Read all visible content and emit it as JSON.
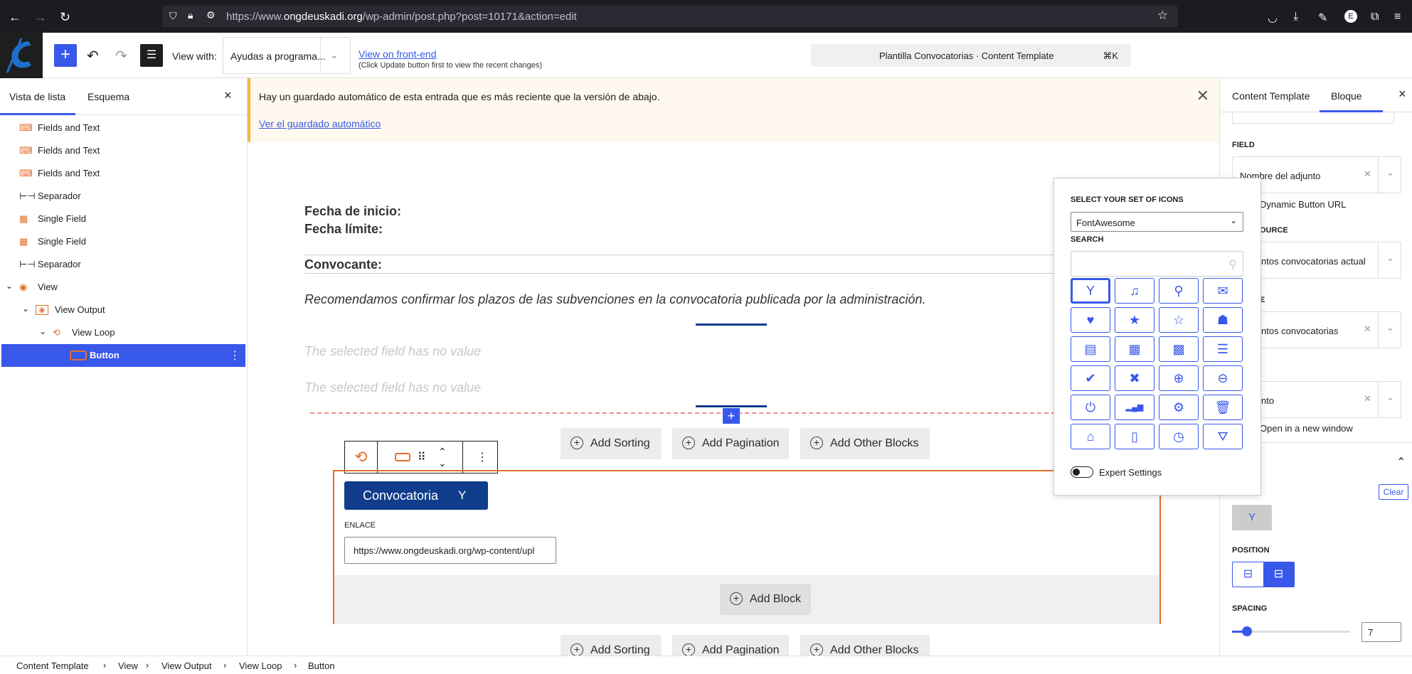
{
  "browser": {
    "url_prefix": "https://www.",
    "url_domain": "ongdeuskadi.org",
    "url_suffix": "/wp-admin/post.php?post=10171&action=edit"
  },
  "header": {
    "view_with_label": "View with:",
    "view_with_value": "Ayudas a programa...",
    "view_front_link": "View on front-end",
    "view_front_note": "(Click Update button first to view the recent changes)",
    "command_title": "Plantilla Convocatorias · Content Template",
    "command_shortcut": "⌘K"
  },
  "left_panel": {
    "tabs": [
      "Vista de lista",
      "Esquema"
    ],
    "items": [
      {
        "label": "Fields and Text"
      },
      {
        "label": "Fields and Text"
      },
      {
        "label": "Fields and Text"
      },
      {
        "label": "Separador"
      },
      {
        "label": "Single Field"
      },
      {
        "label": "Single Field"
      },
      {
        "label": "Separador"
      },
      {
        "label": "View"
      },
      {
        "label": "View Output"
      },
      {
        "label": "View Loop"
      },
      {
        "label": "Button"
      }
    ]
  },
  "notice": {
    "text": "Hay un guardado automático de esta entrada que es más reciente que la versión de abajo.",
    "link": "Ver el guardado automático"
  },
  "canvas": {
    "fecha_inicio": "Fecha de inicio:",
    "fecha_limite": "Fecha límite:",
    "convocante": "Convocante:",
    "recommendation": "Recomendamos confirmar los plazos de las subvenciones en la convocatoria publicada por la administración.",
    "no_value_1": "The selected field has no value",
    "no_value_2": "The selected field has no value",
    "add_sorting": "Add Sorting",
    "add_pagination": "Add Pagination",
    "add_other_blocks": "Add Other Blocks",
    "button_label": "Convocatoria",
    "enlace_label": "ENLACE",
    "enlace_value": "https://www.ongdeuskadi.org/wp-content/upl",
    "add_block": "Add Block"
  },
  "icon_picker": {
    "set_label": "SELECT YOUR SET OF ICONS",
    "set_value": "FontAwesome",
    "search_label": "SEARCH",
    "search_placeholder": "",
    "expert_settings": "Expert Settings",
    "icons": [
      "glass-icon",
      "music-icon",
      "search-icon",
      "envelope-icon",
      "heart-icon",
      "star-icon",
      "star-outline-icon",
      "user-icon",
      "film-icon",
      "th-large-icon",
      "th-icon",
      "th-list-icon",
      "check-icon",
      "times-icon",
      "search-plus-icon",
      "search-minus-icon",
      "power-off-icon",
      "signal-icon",
      "cog-icon",
      "trash-icon",
      "home-icon",
      "file-icon",
      "clock-icon",
      "road-icon"
    ]
  },
  "right_panel": {
    "tabs": [
      "Content Template",
      "Bloque"
    ],
    "field_label": "FIELD",
    "field_value": "Nombre del adjunto",
    "dynamic_url": "Dynamic Button URL",
    "source_label_partial": "OURCE",
    "source_value": "ntos convocatorias actual",
    "type_label_partial": "E",
    "type_value": "ntos convocatorias",
    "field2_value": "nto",
    "open_new_window": "Open in a new window",
    "clear": "Clear",
    "position_label": "POSITION",
    "spacing_label": "SPACING",
    "spacing_value": "7",
    "spacing_fraction": 0.07
  },
  "breadcrumb": [
    "Content Template",
    "View",
    "View Output",
    "View Loop",
    "Button"
  ],
  "colors": {
    "accent": "#3858e9",
    "button_blue": "#0f3d8c",
    "orange": "#e26f2c"
  }
}
